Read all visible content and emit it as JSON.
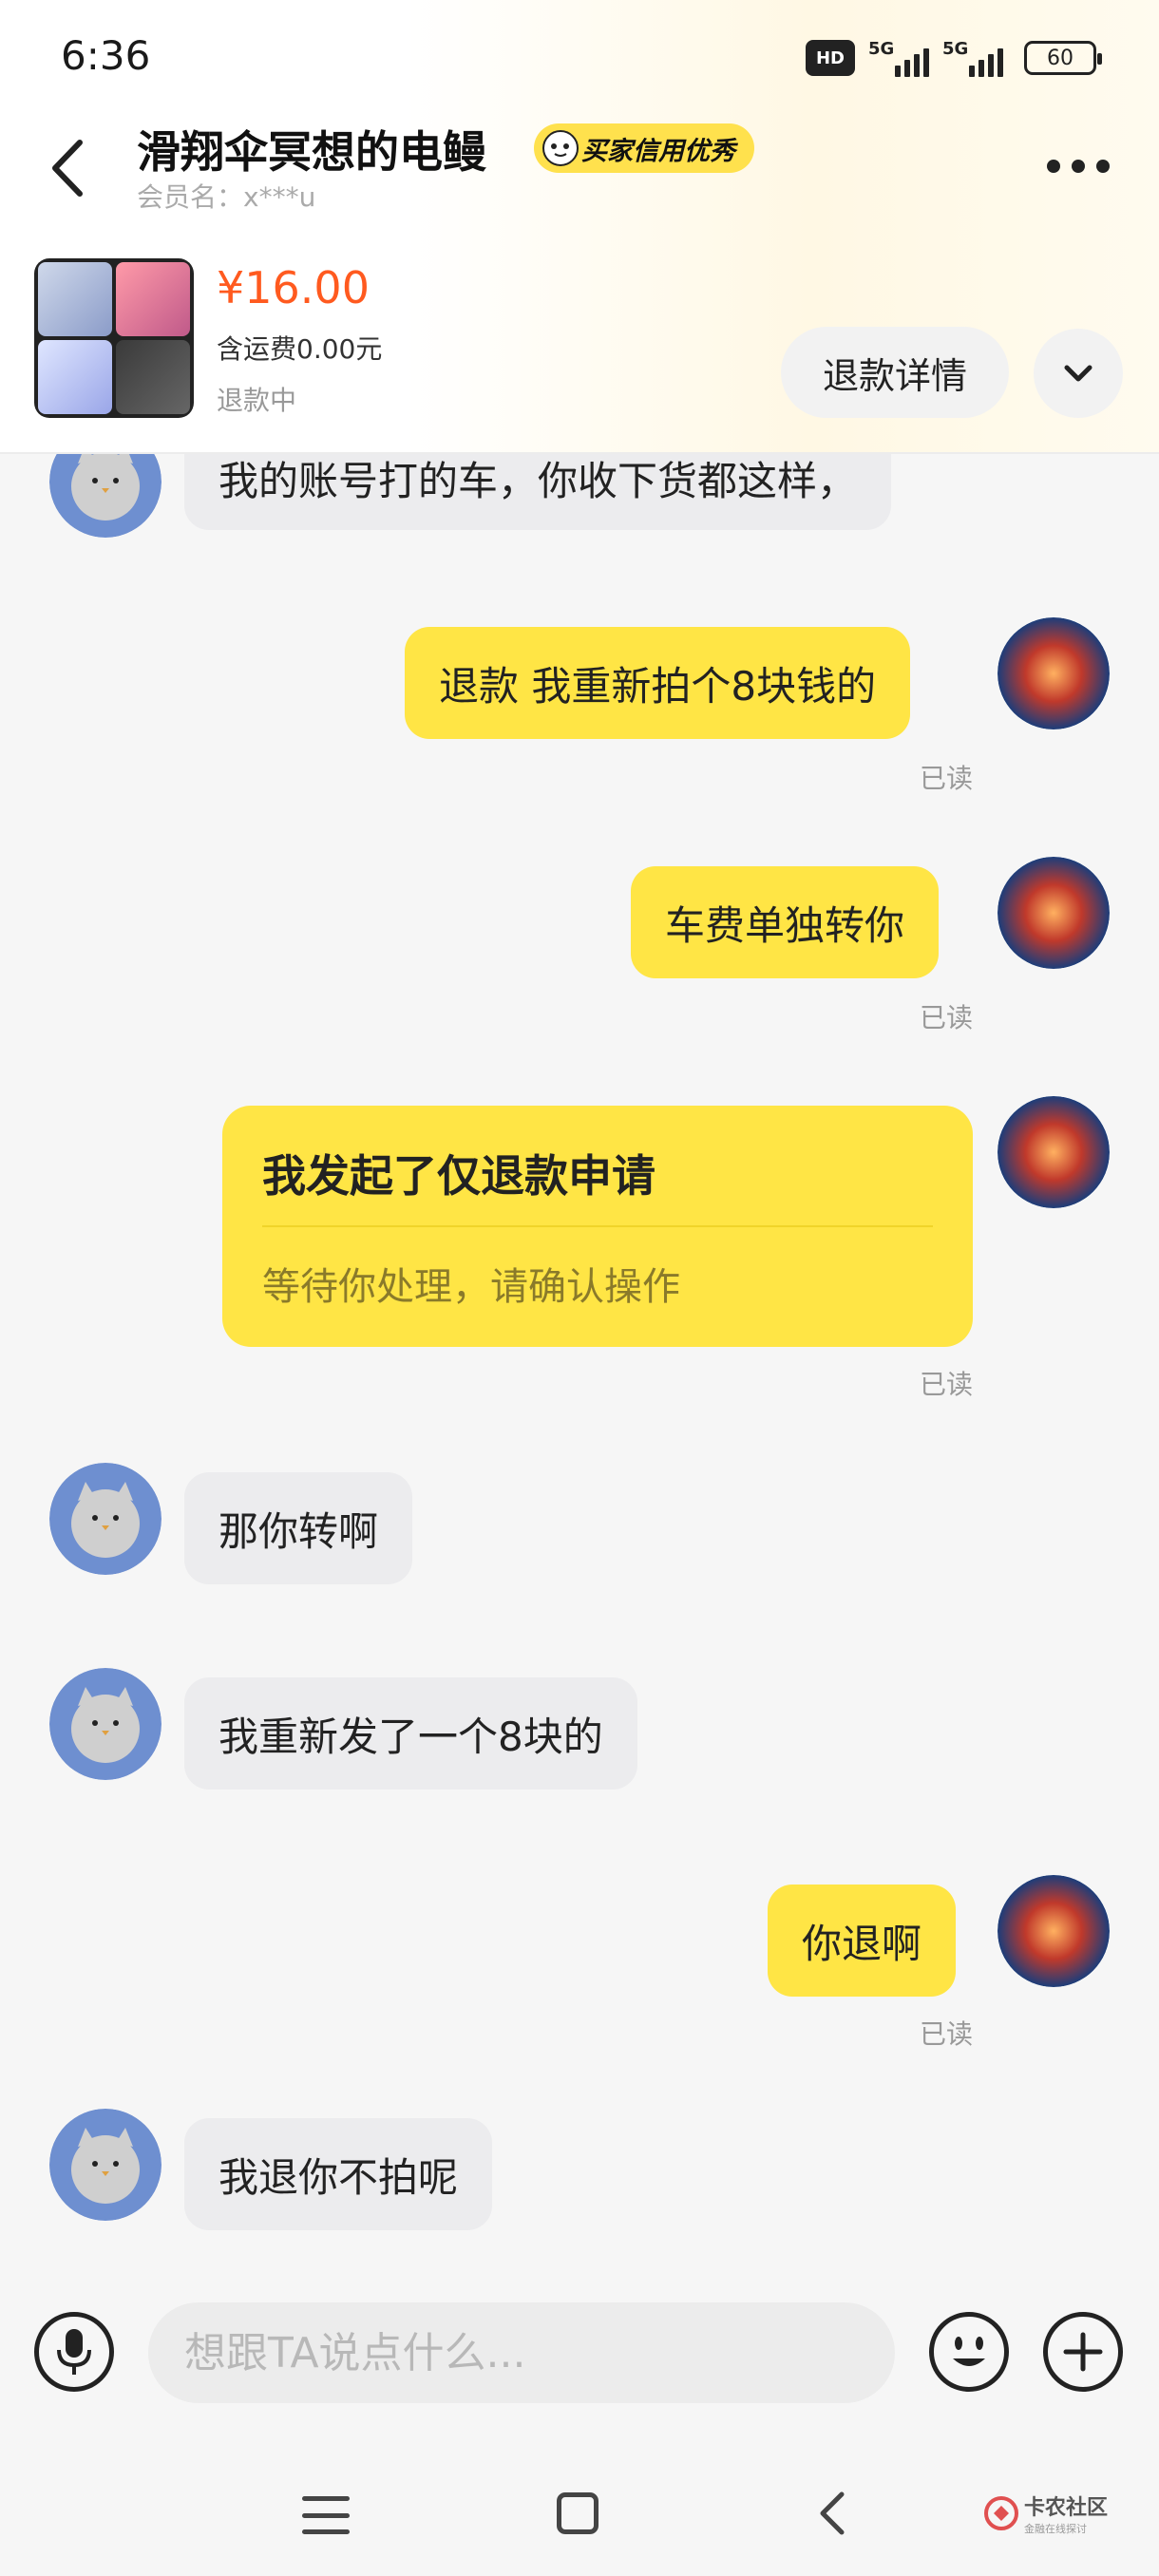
{
  "status_bar": {
    "time": "6:36",
    "hd_label": "HD",
    "signal1_label": "5G",
    "signal2_label": "5G",
    "battery": "60"
  },
  "header": {
    "title": "滑翔伞冥想的电鳗",
    "badge": "买家信用优秀",
    "member_label": "会员名：x***u"
  },
  "order": {
    "price": "¥16.00",
    "shipping": "含运费0.00元",
    "status": "退款中",
    "refund_detail_button": "退款详情"
  },
  "messages": [
    {
      "side": "left",
      "text": "我的账号打的车，你收下货都这样，"
    },
    {
      "side": "right",
      "text": "退款 我重新拍个8块钱的",
      "read": "已读"
    },
    {
      "side": "right",
      "text": "车费单独转你",
      "read": "已读"
    },
    {
      "side": "right",
      "card_title": "我发起了仅退款申请",
      "card_sub": "等待你处理，请确认操作",
      "read": "已读"
    },
    {
      "side": "left",
      "text": "那你转啊"
    },
    {
      "side": "left",
      "text": "我重新发了一个8块的"
    },
    {
      "side": "right",
      "text": "你退啊",
      "read": "已读"
    },
    {
      "side": "left",
      "text": "我退你不拍呢"
    }
  ],
  "input": {
    "placeholder": "想跟TA说点什么..."
  },
  "watermark": {
    "text": "卡农社区",
    "sub": "金融在线探讨"
  },
  "colors": {
    "accent_yellow": "#ffe545",
    "price_orange": "#ff5a1f",
    "left_bubble": "#ececee"
  },
  "icons": [
    "back-arrow-icon",
    "more-dots-icon",
    "chevron-down-icon",
    "microphone-icon",
    "smiley-icon",
    "plus-icon",
    "menu-icon",
    "home-icon",
    "nav-back-icon"
  ]
}
